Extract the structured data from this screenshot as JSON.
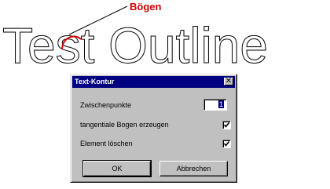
{
  "canvas": {
    "outline_text": "Test Outline",
    "annotation_label": "Bögen",
    "highlight_color": "#d40000"
  },
  "dialog": {
    "title": "Text-Kontur",
    "close_glyph": "✕",
    "fields": {
      "intermediate_points_label": "Zwischenpunkte",
      "intermediate_points_value": "1",
      "tangential_arcs_label": "tangentiale Bogen erzeugen",
      "tangential_arcs_checked": true,
      "delete_element_label": "Element löschen",
      "delete_element_checked": true
    },
    "buttons": {
      "ok_label": "OK",
      "cancel_label": "Abbrechen"
    }
  }
}
